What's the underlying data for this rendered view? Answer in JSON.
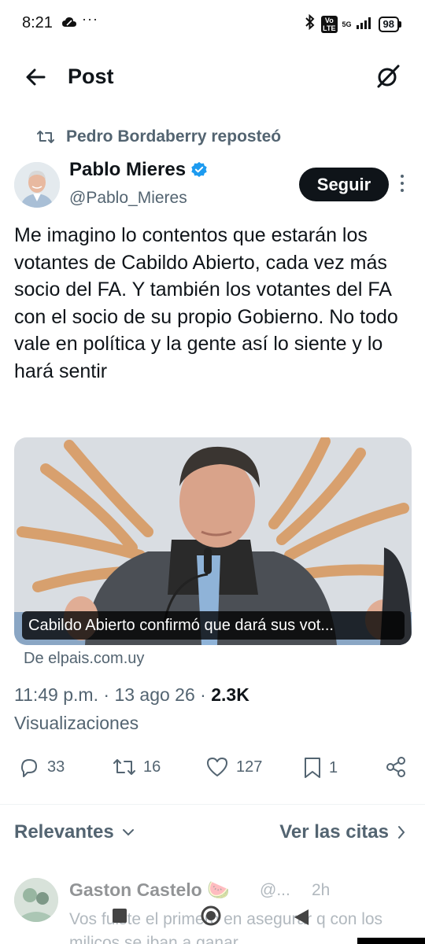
{
  "status_bar": {
    "time": "8:21",
    "dots": "···",
    "volte_top": "Vo",
    "volte_bottom": "LTE",
    "network": "5G",
    "battery": "98"
  },
  "header": {
    "title": "Post"
  },
  "post": {
    "repost_label": "Pedro Bordaberry reposteó",
    "author_name": "Pablo Mieres",
    "author_handle": "@Pablo_Mieres",
    "follow_label": "Seguir",
    "text": "Me imagino lo contentos que estarán los votantes de Cabildo Abierto, cada vez más socio del FA. Y también los votantes del FA con el socio de su propio Gobierno. No todo vale en política y la gente así lo siente y lo hará sentir",
    "media": {
      "caption": "Cabildo Abierto confirmó que dará sus vot...",
      "source": "De elpais.com.uy"
    },
    "time": "11:49 p.m.",
    "date": "13 ago 26",
    "views_count": "2.3K",
    "views_label": "Visualizaciones",
    "stats": {
      "replies": "33",
      "reposts": "16",
      "likes": "127",
      "bookmarks": "1"
    }
  },
  "replies_bar": {
    "sort_label": "Relevantes",
    "quotes_label": "Ver las citas"
  },
  "reply": {
    "author_name": "Gaston Castelo 🍉",
    "handle": "@...",
    "time": "2h",
    "text": "Vos fuiste el primero en asegurar q con los milicos se iban a ganar"
  },
  "icons": {
    "back": "arrow-left-icon",
    "grok": "grok-icon",
    "repost": "repost-icon",
    "verified": "verified-badge-icon",
    "reply": "reply-icon",
    "like": "heart-icon",
    "bookmark": "bookmark-icon",
    "share": "share-icon"
  },
  "colors": {
    "text_primary": "#0f1419",
    "text_secondary": "#536471",
    "verified_blue": "#1d9bf0",
    "follow_bg": "#0f1419"
  }
}
